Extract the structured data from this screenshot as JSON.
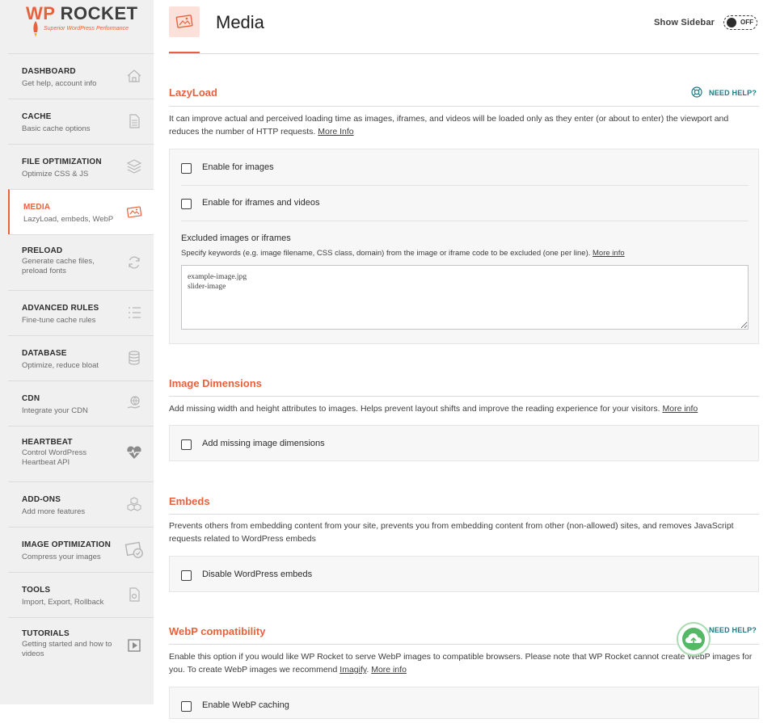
{
  "brand": {
    "wp": "WP",
    "rocket": "ROCKET",
    "tagline": "Superior WordPress Performance",
    "accent": "#e8613d",
    "link_teal": "#1f7a84"
  },
  "sidebar": {
    "items": [
      {
        "title": "DASHBOARD",
        "desc": "Get help, account info",
        "icon": "house-icon"
      },
      {
        "title": "CACHE",
        "desc": "Basic cache options",
        "icon": "document-icon"
      },
      {
        "title": "FILE OPTIMIZATION",
        "desc": "Optimize CSS & JS",
        "icon": "layers-icon"
      },
      {
        "title": "MEDIA",
        "desc": "LazyLoad, embeds, WebP",
        "icon": "media-icon",
        "active": true
      },
      {
        "title": "PRELOAD",
        "desc": "Generate cache files, preload fonts",
        "icon": "refresh-icon"
      },
      {
        "title": "ADVANCED RULES",
        "desc": "Fine-tune cache rules",
        "icon": "list-icon"
      },
      {
        "title": "DATABASE",
        "desc": "Optimize, reduce bloat",
        "icon": "database-icon"
      },
      {
        "title": "CDN",
        "desc": "Integrate your CDN",
        "icon": "globe-hand-icon"
      },
      {
        "title": "HEARTBEAT",
        "desc": "Control WordPress Heartbeat API",
        "icon": "heartbeat-icon"
      },
      {
        "title": "ADD-ONS",
        "desc": "Add more features",
        "icon": "cubes-icon"
      },
      {
        "title": "IMAGE OPTIMIZATION",
        "desc": "Compress your images",
        "icon": "image-optimize-icon"
      },
      {
        "title": "TOOLS",
        "desc": "Import, Export, Rollback",
        "icon": "tools-icon"
      },
      {
        "title": "TUTORIALS",
        "desc": "Getting started and how to videos",
        "icon": "play-icon"
      }
    ]
  },
  "header": {
    "title": "Media",
    "show_sidebar_label": "Show Sidebar",
    "toggle_state": "OFF"
  },
  "lazyload": {
    "title": "LazyLoad",
    "help": "NEED HELP?",
    "desc": "It can improve actual and perceived loading time as images, iframes, and videos will be loaded only as they enter (or about to enter) the viewport and reduces the number of HTTP requests.",
    "more": "More Info",
    "opt_images": "Enable for images",
    "opt_iframes": "Enable for iframes and videos",
    "excluded_title": "Excluded images or iframes",
    "excluded_desc": "Specify keywords (e.g. image filename, CSS class, domain) from the image or iframe code to be excluded (one per line).",
    "excluded_more": "More info",
    "excluded_value": "example-image.jpg\nslider-image"
  },
  "image_dimensions": {
    "title": "Image Dimensions",
    "desc": "Add missing width and height attributes to images. Helps prevent layout shifts and improve the reading experience for your visitors.",
    "more": "More info",
    "opt": "Add missing image dimensions"
  },
  "embeds": {
    "title": "Embeds",
    "desc": "Prevents others from embedding content from your site, prevents you from embedding content from other (non-allowed) sites, and removes JavaScript requests related to WordPress embeds",
    "opt": "Disable WordPress embeds"
  },
  "webp": {
    "title": "WebP compatibility",
    "help": "NEED HELP?",
    "desc": "Enable this option if you would like WP Rocket to serve WebP images to compatible browsers. Please note that WP Rocket cannot create WebP images for you. To create WebP images we recommend",
    "imagify": "Imagify",
    "more": "More info",
    "opt": "Enable WebP caching"
  }
}
